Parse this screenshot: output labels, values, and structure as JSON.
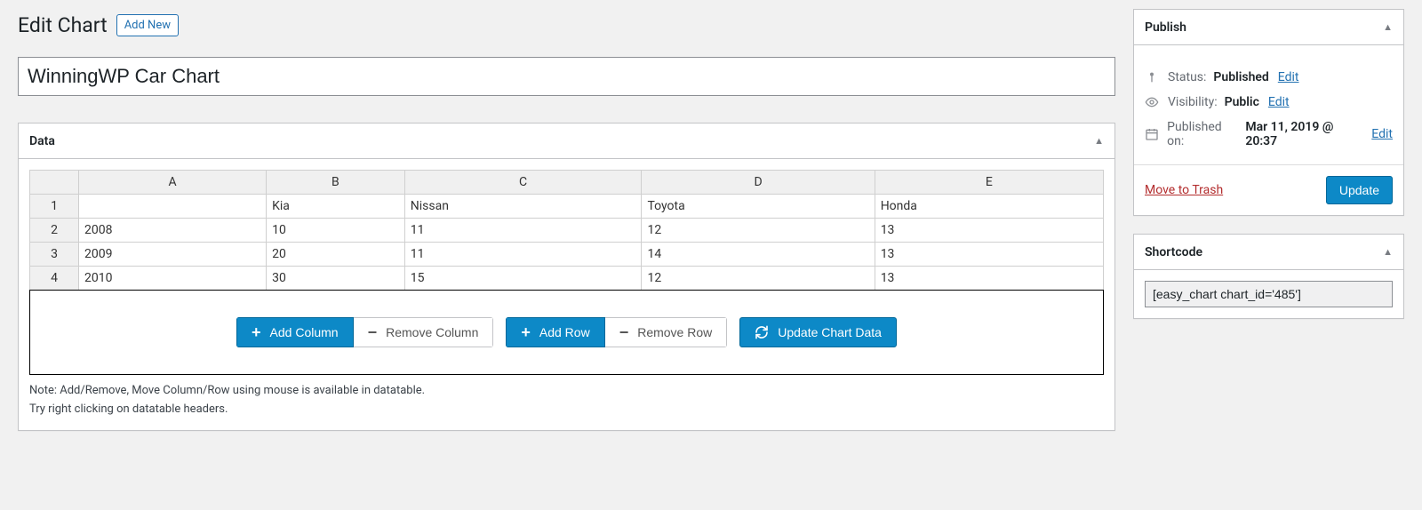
{
  "header": {
    "title": "Edit Chart",
    "add_new": "Add New"
  },
  "chart_title": "WinningWP Car Chart",
  "data_panel": {
    "title": "Data",
    "columns": [
      "A",
      "B",
      "C",
      "D",
      "E"
    ],
    "rows": [
      {
        "n": "1",
        "cells": [
          "",
          "Kia",
          "Nissan",
          "Toyota",
          "Honda"
        ]
      },
      {
        "n": "2",
        "cells": [
          "2008",
          "10",
          "11",
          "12",
          "13"
        ]
      },
      {
        "n": "3",
        "cells": [
          "2009",
          "20",
          "11",
          "14",
          "13"
        ]
      },
      {
        "n": "4",
        "cells": [
          "2010",
          "30",
          "15",
          "12",
          "13"
        ]
      }
    ],
    "buttons": {
      "add_column": "Add Column",
      "remove_column": "Remove Column",
      "add_row": "Add Row",
      "remove_row": "Remove Row",
      "update_chart": "Update Chart Data"
    },
    "note1": "Note: Add/Remove, Move Column/Row using mouse is available in datatable.",
    "note2": "Try right clicking on datatable headers."
  },
  "publish": {
    "title": "Publish",
    "status_label": "Status:",
    "status_value": "Published",
    "visibility_label": "Visibility:",
    "visibility_value": "Public",
    "published_label": "Published on:",
    "published_value": "Mar 11, 2019 @ 20:37",
    "edit": "Edit",
    "move_trash": "Move to Trash",
    "update": "Update"
  },
  "shortcode": {
    "title": "Shortcode",
    "value": "[easy_chart chart_id='485']"
  },
  "chart_data": {
    "type": "table",
    "title": "WinningWP Car Chart",
    "categories": [
      "2008",
      "2009",
      "2010"
    ],
    "series": [
      {
        "name": "Kia",
        "values": [
          10,
          20,
          30
        ]
      },
      {
        "name": "Nissan",
        "values": [
          11,
          11,
          15
        ]
      },
      {
        "name": "Toyota",
        "values": [
          12,
          14,
          12
        ]
      },
      {
        "name": "Honda",
        "values": [
          13,
          13,
          13
        ]
      }
    ]
  }
}
